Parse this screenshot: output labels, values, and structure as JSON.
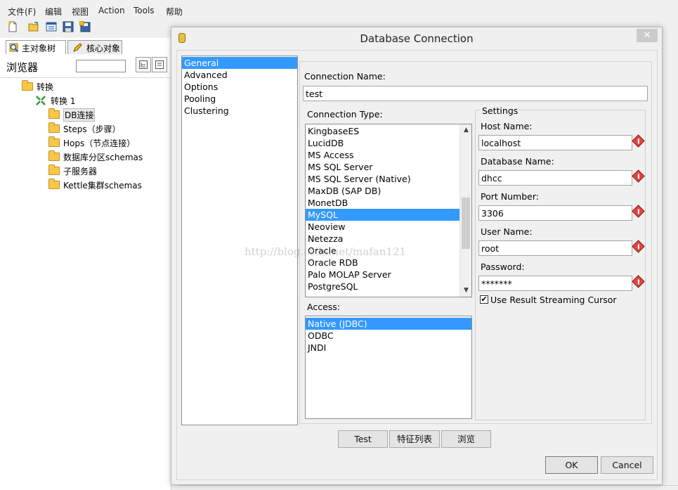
{
  "menubar": {
    "items": [
      "文件(F)",
      "编辑",
      "视图",
      "Action",
      "Tools",
      "帮助"
    ]
  },
  "toolbar": {
    "icons": [
      "new-file-icon",
      "open-folder-icon",
      "explore-icon",
      "save-icon",
      "save-as-icon"
    ]
  },
  "left_panel": {
    "tabs": [
      "主对象树",
      "核心对象"
    ],
    "browser_label": "浏览器",
    "tree": {
      "root": "转换",
      "child": "转换 1",
      "items": [
        "DB连接",
        "Steps（步骤）",
        "Hops（节点连接）",
        "数据库分区schemas",
        "子服务器",
        "Kettle集群schemas"
      ]
    }
  },
  "dialog": {
    "title": "Database Connection",
    "close_glyph": "✕",
    "categories": [
      "General",
      "Advanced",
      "Options",
      "Pooling",
      "Clustering"
    ],
    "selected_category": "General",
    "connection_name_label": "Connection Name:",
    "connection_name_value": "test",
    "connection_type_label": "Connection Type:",
    "connection_types": [
      "KingbaseES",
      "LucidDB",
      "MS Access",
      "MS SQL Server",
      "MS SQL Server (Native)",
      "MaxDB (SAP DB)",
      "MonetDB",
      "MySQL",
      "Neoview",
      "Netezza",
      "Oracle",
      "Oracle RDB",
      "Palo MOLAP Server",
      "PostgreSQL"
    ],
    "selected_connection_type": "MySQL",
    "access_label": "Access:",
    "access_options": [
      "Native (JDBC)",
      "ODBC",
      "JNDI"
    ],
    "selected_access": "Native (JDBC)",
    "settings": {
      "title": "Settings",
      "host_label": "Host Name:",
      "host_value": "localhost",
      "db_label": "Database Name:",
      "db_value": "dhcc",
      "port_label": "Port Number:",
      "port_value": "3306",
      "user_label": "User Name:",
      "user_value": "root",
      "password_label": "Password:",
      "password_value": "*******",
      "streaming_label": "Use Result Streaming Cursor",
      "streaming_checked": "✔"
    },
    "buttons": {
      "test": "Test",
      "features": "特征列表",
      "explore": "浏览",
      "ok": "OK",
      "cancel": "Cancel"
    }
  },
  "watermark": "http://blog.csdn.net/mafan121",
  "colors": {
    "selection": "#3399ff",
    "warning": "#e2453f",
    "folder": "#f7c845"
  }
}
